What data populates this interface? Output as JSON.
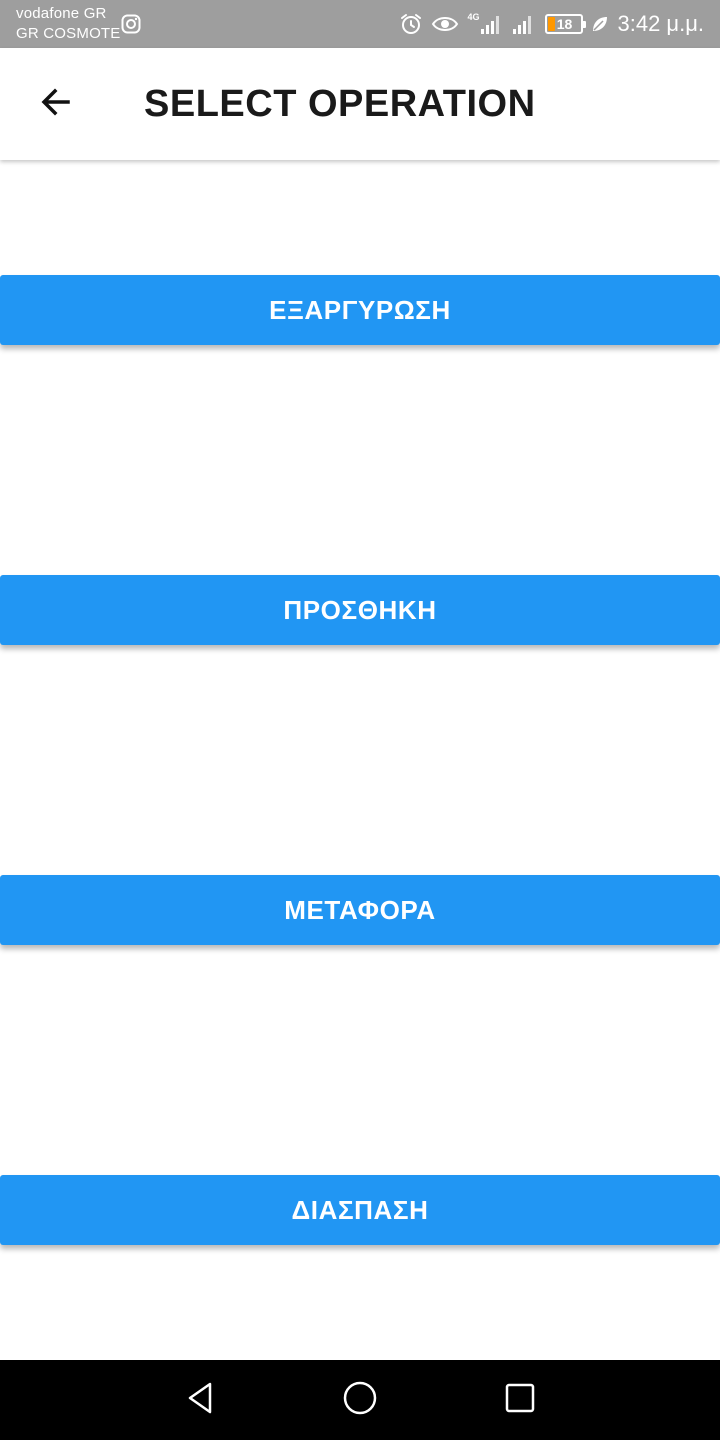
{
  "status_bar": {
    "carrier_1": "vodafone GR",
    "carrier_2": "GR COSMOTE",
    "network_type": "4G",
    "battery_level": "18",
    "time": "3:42 μ.μ.",
    "icons": [
      "instagram-icon",
      "alarm-icon",
      "eye-icon",
      "signal-icon",
      "battery-icon",
      "leaf-icon"
    ],
    "battery_color": "#ff9800"
  },
  "header": {
    "title": "SELECT OPERATION",
    "back_icon": "arrow-left-icon"
  },
  "operations": {
    "items": [
      {
        "label": "ΕΞΑΡΓΥΡΩΣΗ"
      },
      {
        "label": "ΠΡΟΣΘΗΚΗ"
      },
      {
        "label": "ΜΕΤΑΦΟΡΑ"
      },
      {
        "label": "ΔΙΑΣΠΑΣΗ"
      }
    ],
    "button_color": "#2196f3"
  },
  "nav_bar": {
    "icons": [
      "triangle-back-icon",
      "circle-home-icon",
      "square-recents-icon"
    ]
  }
}
